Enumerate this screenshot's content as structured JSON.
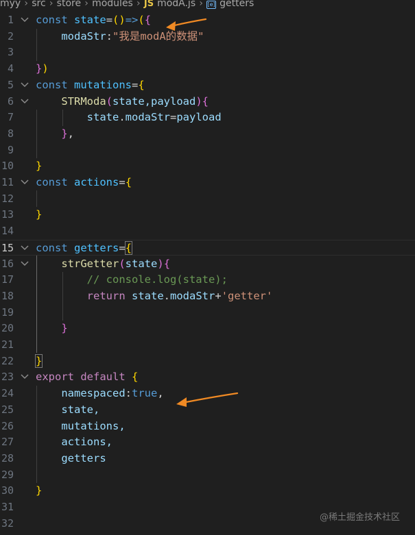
{
  "breadcrumb": {
    "items": [
      "myy",
      "src",
      "store",
      "modules",
      "modA.js",
      "getters"
    ],
    "separator": "›",
    "file_icon": "JS",
    "symbol_icon": "symbol-variable-icon"
  },
  "lines": [
    {
      "n": "1"
    },
    {
      "n": "2"
    },
    {
      "n": "3"
    },
    {
      "n": "4"
    },
    {
      "n": "5"
    },
    {
      "n": "6"
    },
    {
      "n": "7"
    },
    {
      "n": "8"
    },
    {
      "n": "9"
    },
    {
      "n": "10"
    },
    {
      "n": "11"
    },
    {
      "n": "12"
    },
    {
      "n": "13"
    },
    {
      "n": "14"
    },
    {
      "n": "15"
    },
    {
      "n": "16"
    },
    {
      "n": "17"
    },
    {
      "n": "18"
    },
    {
      "n": "19"
    },
    {
      "n": "20"
    },
    {
      "n": "21"
    },
    {
      "n": "22"
    },
    {
      "n": "23"
    },
    {
      "n": "24"
    },
    {
      "n": "25"
    },
    {
      "n": "26"
    },
    {
      "n": "27"
    },
    {
      "n": "28"
    },
    {
      "n": "29"
    },
    {
      "n": "30"
    },
    {
      "n": "31"
    },
    {
      "n": "32"
    }
  ],
  "code": {
    "l1_kw": "const",
    "l1_name": "state",
    "l1_op": "=",
    "l1_paren": "()",
    "l1_arrow": "=>",
    "l1_p": "(",
    "l1_b": "{",
    "l2_key": "modaStr",
    "l2_colon": ":",
    "l2_val": "\"我是modA的数据\"",
    "l4_b": "}",
    "l4_p": ")",
    "l5_kw": "const",
    "l5_name": "mutations",
    "l5_op": "=",
    "l5_b": "{",
    "l6_fn": "STRModa",
    "l6_p": "(",
    "l6_args": "state,payload",
    "l6_pc": ")",
    "l6_b": "{",
    "l7_obj": "state",
    "l7_dot": ".",
    "l7_prop": "modaStr",
    "l7_op": "=",
    "l7_val": "payload",
    "l8_b": "}",
    "l8_c": ",",
    "l10_b": "}",
    "l11_kw": "const",
    "l11_name": "actions",
    "l11_op": "=",
    "l11_b": "{",
    "l13_b": "}",
    "l15_kw": "const",
    "l15_name": "getters",
    "l15_op": "=",
    "l15_b": "{",
    "l16_fn": "strGetter",
    "l16_p": "(",
    "l16_args": "state",
    "l16_pc": ")",
    "l16_b": "{",
    "l17_cm": "// console.log(state);",
    "l18_kw": "return",
    "l18_obj": "state",
    "l18_dot": ".",
    "l18_prop": "modaStr",
    "l18_op": "+",
    "l18_str": "'getter'",
    "l20_b": "}",
    "l22_b": "}",
    "l23_kw1": "export",
    "l23_kw2": "default",
    "l23_b": "{",
    "l24_key": "namespaced",
    "l24_colon": ":",
    "l24_val": "true",
    "l24_c": ",",
    "l25": "state,",
    "l26": "mutations,",
    "l27": "actions,",
    "l28": "getters",
    "l30_b": "}"
  },
  "annotations": {
    "arrow_color": "#f08a24"
  },
  "watermark": "@稀土掘金技术社区",
  "colors": {
    "background": "#1f1f1f",
    "keyword": "#569cd6",
    "variable": "#4fc1ff",
    "function": "#dcdcaa",
    "property": "#9cdcfe",
    "string": "#ce9178",
    "comment": "#6a9955",
    "control": "#c586c0"
  }
}
